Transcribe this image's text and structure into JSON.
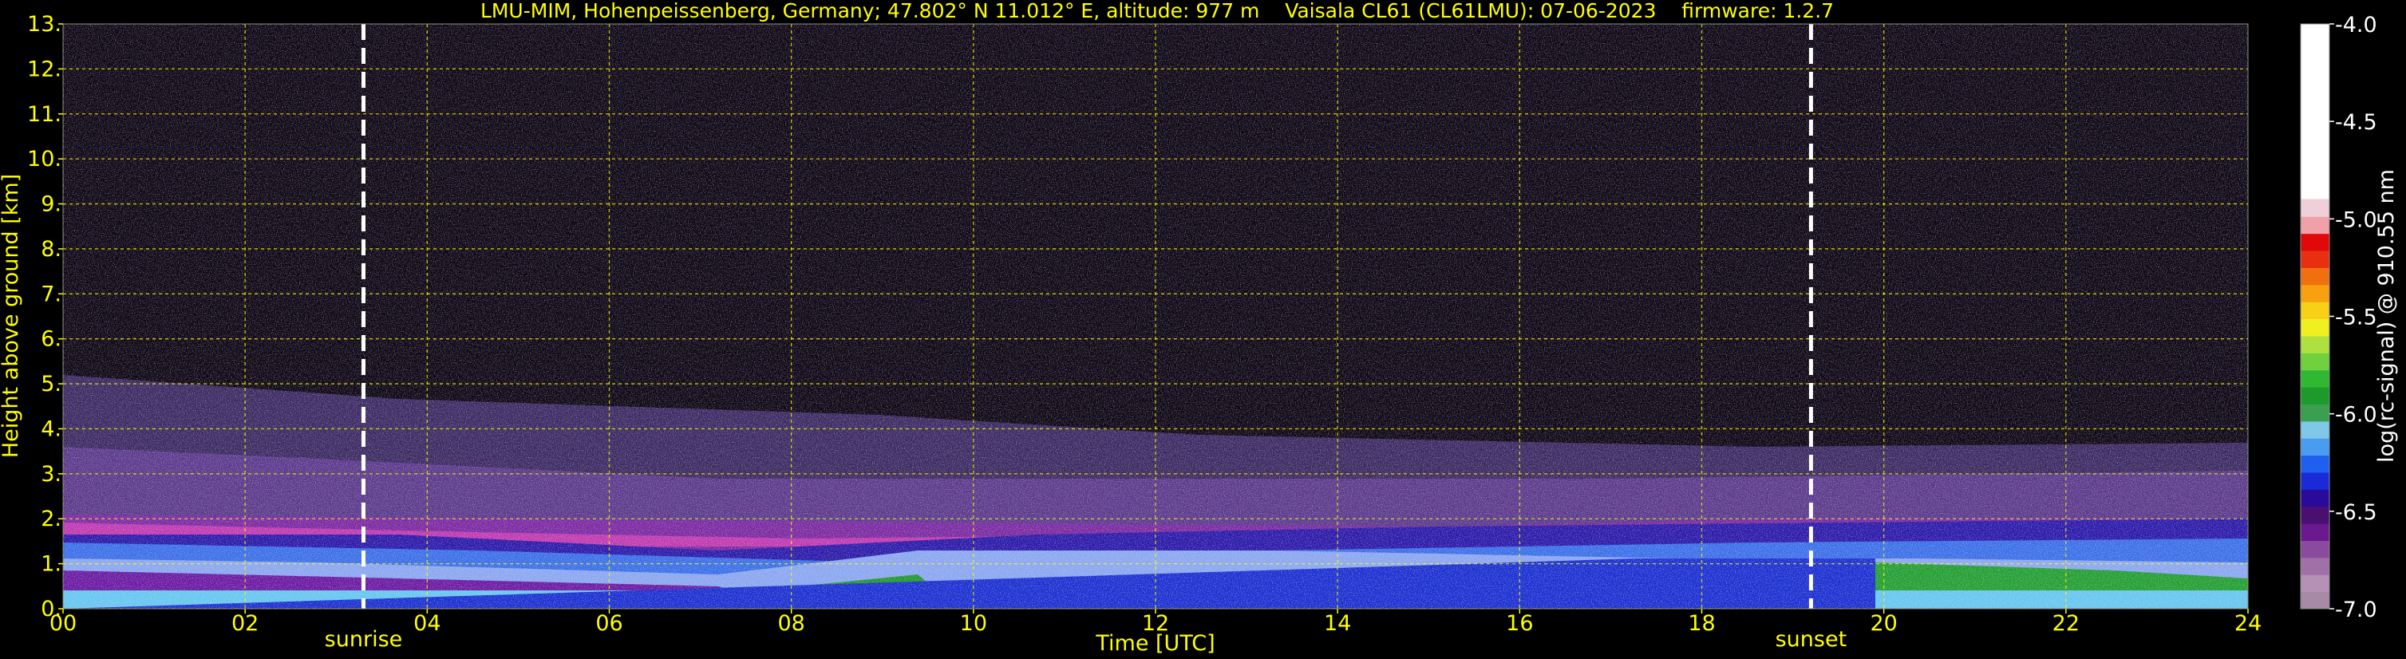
{
  "title": "LMU-MIM, Hohenpeissenberg, Germany; 47.802° N 11.012° E, altitude: 977 m    Vaisala CL61 (CL61LMU): 07-06-2023    firmware: 1.2.7",
  "chart_data": {
    "type": "heatmap",
    "xlabel": "Time [UTC]",
    "ylabel": "Height above ground [km]",
    "xlim": [
      0,
      24
    ],
    "ylim": [
      0,
      13
    ],
    "x_ticks": [
      "00",
      "02",
      "04",
      "06",
      "08",
      "10",
      "12",
      "14",
      "16",
      "18",
      "20",
      "22",
      "24"
    ],
    "y_ticks": [
      "0.",
      "1.",
      "2.",
      "3.",
      "4.",
      "5.",
      "6.",
      "7.",
      "8.",
      "9.",
      "10.",
      "11.",
      "12.",
      "13."
    ],
    "grid": true,
    "markers": [
      {
        "label": "sunrise",
        "x": 3.3
      },
      {
        "label": "sunset",
        "x": 19.2
      }
    ],
    "colorbar": {
      "label": "log(rc-signal) @ 910.55 nm",
      "range": [
        -7.0,
        -4.0
      ],
      "ticks": [
        "-4.0",
        "-4.5",
        "-5.0",
        "-5.5",
        "-6.0",
        "-6.5",
        "-7.0"
      ],
      "colors": [
        "#a68aa6",
        "#b592b5",
        "#a070a8",
        "#8a4a9e",
        "#6a1a8e",
        "#4a1070",
        "#2a0a9a",
        "#1a2ad8",
        "#2060f0",
        "#4a9cf0",
        "#7fc8e8",
        "#3aa050",
        "#1e9a2a",
        "#30b832",
        "#70d040",
        "#b0e040",
        "#f0f020",
        "#f8d018",
        "#f8a010",
        "#f07010",
        "#e83010",
        "#e00808",
        "#f0a0a8",
        "#f0d0d8",
        "#ffffff"
      ]
    }
  }
}
